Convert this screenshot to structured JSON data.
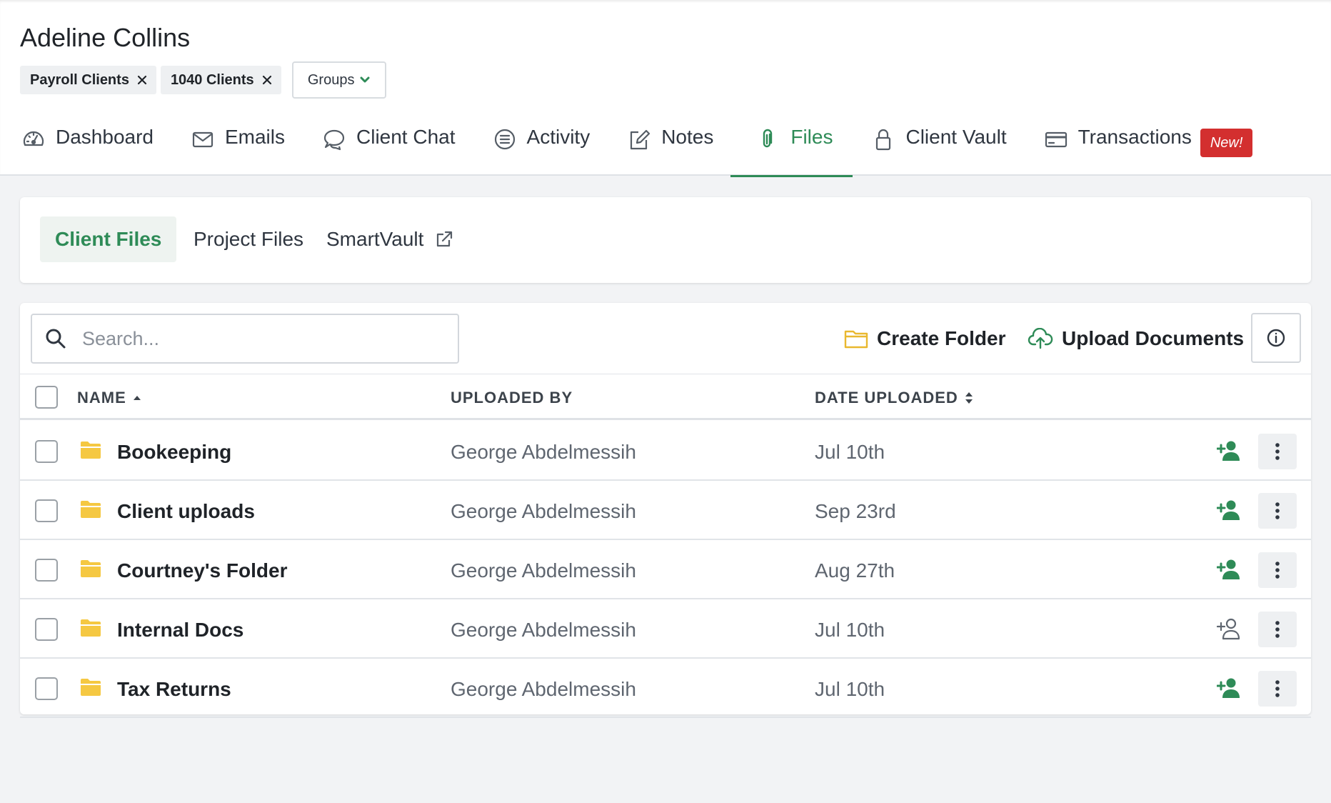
{
  "client": {
    "name": "Adeline Collins",
    "tags": [
      "Payroll Clients",
      "1040 Clients"
    ],
    "groups_label": "Groups"
  },
  "tabs": [
    {
      "label": "Dashboard",
      "icon": "dashboard-gauge-icon"
    },
    {
      "label": "Emails",
      "icon": "envelope-icon"
    },
    {
      "label": "Client Chat",
      "icon": "chat-bubbles-icon"
    },
    {
      "label": "Activity",
      "icon": "list-circle-icon"
    },
    {
      "label": "Notes",
      "icon": "edit-note-icon"
    },
    {
      "label": "Files",
      "icon": "paperclip-icon",
      "active": true
    },
    {
      "label": "Client Vault",
      "icon": "lock-icon"
    },
    {
      "label": "Transactions",
      "icon": "credit-card-icon",
      "badge": "New!"
    }
  ],
  "subtabs": [
    {
      "label": "Client Files",
      "active": true
    },
    {
      "label": "Project Files"
    },
    {
      "label": "SmartVault",
      "icon": "external-link-icon"
    }
  ],
  "toolbar": {
    "search_placeholder": "Search...",
    "create_folder": "Create Folder",
    "upload_documents": "Upload Documents"
  },
  "table": {
    "columns": {
      "name": "NAME",
      "uploaded_by": "UPLOADED BY",
      "date_uploaded": "DATE UPLOADED"
    },
    "rows": [
      {
        "name": "Bookeeping",
        "uploaded_by": "George Abdelmessih",
        "date": "Jul 10th",
        "shared": true
      },
      {
        "name": "Client uploads",
        "uploaded_by": "George Abdelmessih",
        "date": "Sep 23rd",
        "shared": true
      },
      {
        "name": "Courtney's Folder",
        "uploaded_by": "George Abdelmessih",
        "date": "Aug 27th",
        "shared": true
      },
      {
        "name": "Internal Docs",
        "uploaded_by": "George Abdelmessih",
        "date": "Jul 10th",
        "shared": false
      },
      {
        "name": "Tax Returns",
        "uploaded_by": "George Abdelmessih",
        "date": "Jul 10th",
        "shared": true
      }
    ]
  },
  "colors": {
    "accent_green": "#2e8b57",
    "folder_yellow": "#f5c842",
    "badge_red": "#d32f2f"
  }
}
